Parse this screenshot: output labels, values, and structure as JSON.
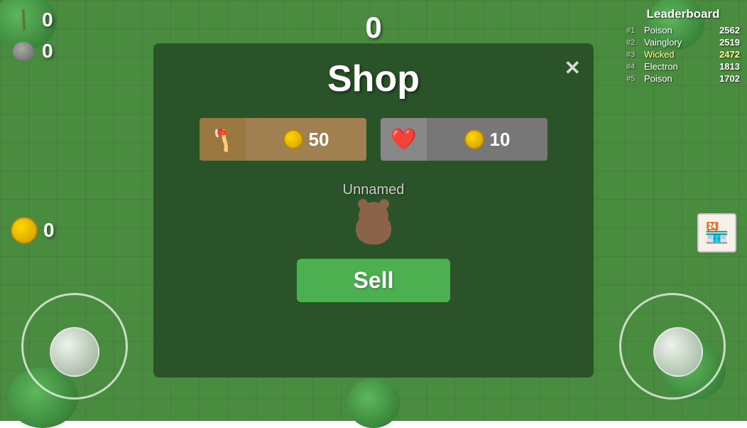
{
  "game": {
    "score_center": "0",
    "resources": {
      "sticks": "0",
      "rocks": "0"
    },
    "gold": "0"
  },
  "leaderboard": {
    "title": "Leaderboard",
    "entries": [
      {
        "rank": "#1",
        "name": "Poison",
        "score": "2562",
        "highlighted": false
      },
      {
        "rank": "#2",
        "name": "Vainglory",
        "score": "2519",
        "highlighted": false
      },
      {
        "rank": "#3",
        "name": "Wicked",
        "score": "2472",
        "highlighted": true
      },
      {
        "rank": "#4",
        "name": "Electron",
        "score": "1813",
        "highlighted": false
      },
      {
        "rank": "#5",
        "name": "Poison",
        "score": "1702",
        "highlighted": false
      }
    ]
  },
  "shop": {
    "title": "Shop",
    "close_label": "✕",
    "items": [
      {
        "icon": "axe",
        "price": "50",
        "type": "tool"
      },
      {
        "icon": "heart",
        "price": "10",
        "type": "health"
      }
    ],
    "player_name": "Unnamed",
    "sell_label": "Sell"
  }
}
